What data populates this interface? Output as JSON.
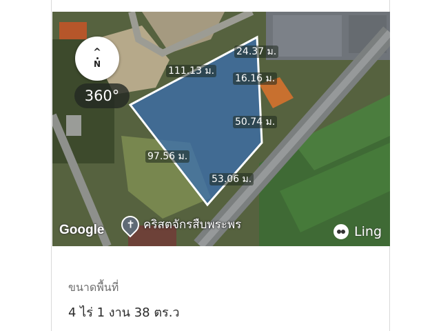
{
  "map": {
    "compass_label": "N",
    "view_360_label": "360°",
    "google_label": "Google",
    "place_icon": "cross-pin-icon",
    "place_name": "คริสตจักรสืบพระพร",
    "brand_icon": "monkey-face-icon",
    "brand_name": "Ling",
    "plot_fill": "#3b6fb0",
    "plot_stroke": "#ffffff",
    "measurements": [
      {
        "id": "m1",
        "text": "24.37 ม."
      },
      {
        "id": "m2",
        "text": "111.13 ม."
      },
      {
        "id": "m3",
        "text": "16.16 ม."
      },
      {
        "id": "m4",
        "text": "50.74 ม."
      },
      {
        "id": "m5",
        "text": "97.56 ม."
      },
      {
        "id": "m6",
        "text": "53.06 ม."
      }
    ]
  },
  "details": {
    "size_label": "ขนาดพื้นที่",
    "size_value": "4 ไร่ 1 งาน 38 ตร.ว"
  }
}
